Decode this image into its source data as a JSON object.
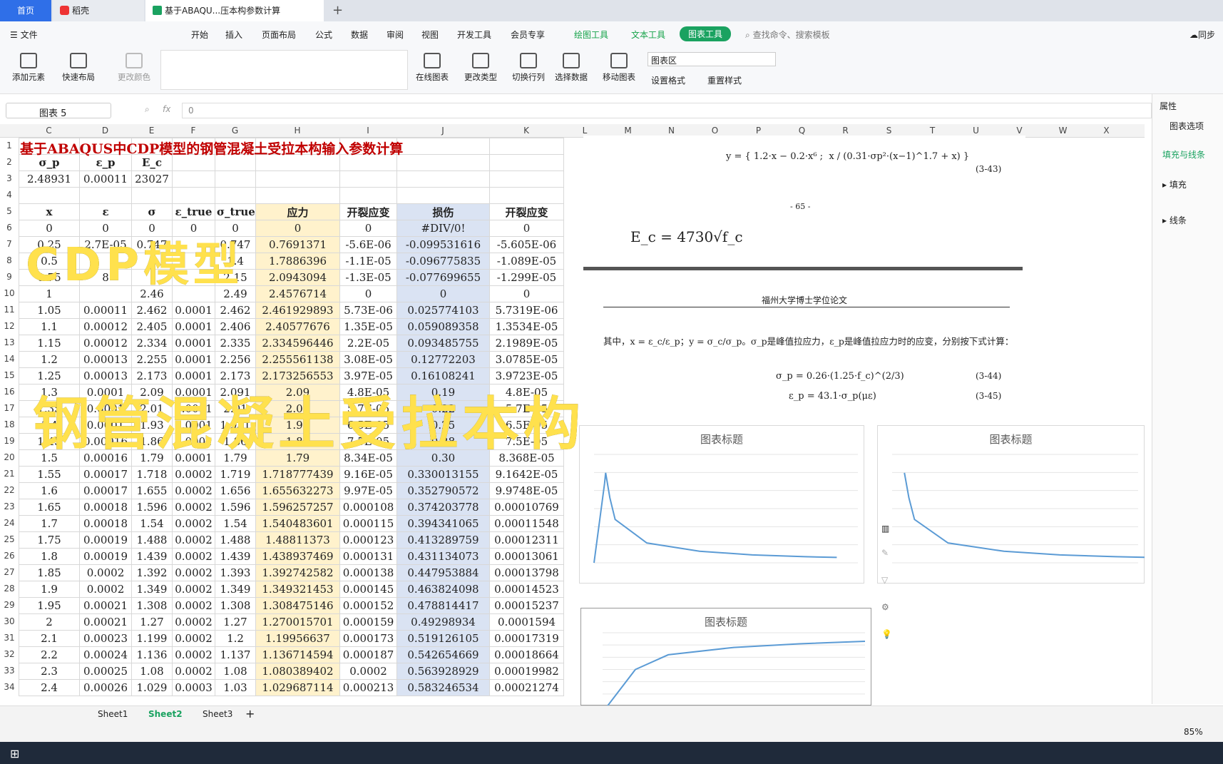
{
  "tabs": {
    "home": "首页",
    "daoke": "稻壳",
    "file": "基于ABAQU...压本构参数计算"
  },
  "menu": {
    "file": "文件",
    "items": [
      "开始",
      "插入",
      "页面布局",
      "公式",
      "数据",
      "审阅",
      "视图",
      "开发工具",
      "会员专享"
    ],
    "draw_tool": "绘图工具",
    "text_tool": "文本工具",
    "chart_tool": "图表工具",
    "search": "查找命令、搜索模板",
    "sync": "同步"
  },
  "ribbon": {
    "add_element": "添加元素",
    "quick_layout": "快速布局",
    "change_color": "更改颜色",
    "online_chart": "在线图表",
    "change_type": "更改类型",
    "switch_rowcol": "切换行列",
    "select_data": "选择数据",
    "move_chart": "移动图表",
    "chart_area": "图表区",
    "set_format": "设置格式",
    "reset_style": "重置样式"
  },
  "formula_bar": {
    "name_box": "图表 5",
    "fx": "fx",
    "value": "0"
  },
  "columns": [
    "C",
    "D",
    "E",
    "F",
    "G",
    "H",
    "I",
    "J",
    "K",
    "L",
    "M",
    "N",
    "O",
    "P",
    "Q",
    "R",
    "S",
    "T",
    "U",
    "V",
    "W",
    "X"
  ],
  "title": "基于ABAQUS中CDP模型的钢管混凝土受拉本构输入参数计算",
  "header_row2": [
    "σ_p",
    "ε_p",
    "E_c"
  ],
  "values_row3": [
    "2.48931",
    "0.00011",
    "23027"
  ],
  "header_row5": [
    "x",
    "ε",
    "σ",
    "ε_true",
    "σ_true",
    "应力",
    "开裂应变",
    "损伤",
    "开裂应变"
  ],
  "rows": [
    [
      "0",
      "0",
      "0",
      "0",
      "0",
      "0",
      "0",
      "#DIV/0!",
      "0"
    ],
    [
      "0.25",
      "2.7E-05",
      "0.747",
      "",
      "0.747",
      "0.7691371",
      "-5.6E-06",
      "-0.099531616",
      "-5.605E-06"
    ],
    [
      "0.5",
      "",
      "",
      "",
      "1.4",
      "1.7886396",
      "-1.1E-05",
      "-0.096775835",
      "-1.089E-05"
    ],
    [
      "0.75",
      "8",
      "",
      "",
      "2.15",
      "2.0943094",
      "-1.3E-05",
      "-0.077699655",
      "-1.299E-05"
    ],
    [
      "1",
      "",
      "2.46",
      "",
      "2.49",
      "2.4576714",
      "0",
      "0",
      "0"
    ],
    [
      "1.05",
      "0.00011",
      "2.462",
      "0.0001",
      "2.462",
      "2.461929893",
      "5.73E-06",
      "0.025774103",
      "5.7319E-06"
    ],
    [
      "1.1",
      "0.00012",
      "2.405",
      "0.0001",
      "2.406",
      "2.40577676",
      "1.35E-05",
      "0.059089358",
      "1.3534E-05"
    ],
    [
      "1.15",
      "0.00012",
      "2.334",
      "0.0001",
      "2.335",
      "2.334596446",
      "2.2E-05",
      "0.093485755",
      "2.1989E-05"
    ],
    [
      "1.2",
      "0.00013",
      "2.255",
      "0.0001",
      "2.256",
      "2.255561138",
      "3.08E-05",
      "0.12772203",
      "3.0785E-05"
    ],
    [
      "1.25",
      "0.00013",
      "2.173",
      "0.0001",
      "2.173",
      "2.173256553",
      "3.97E-05",
      "0.16108241",
      "3.9723E-05"
    ],
    [
      "1.3",
      "0.0001",
      "2.09",
      "0.0001",
      "2.091",
      "2.09",
      "4.8E-05",
      "0.19",
      "4.8E-05"
    ],
    [
      "1.35",
      "0.0001",
      "2.01",
      "0.0001",
      "2.01",
      "2.01",
      "5.7E-05",
      "0.22",
      "5.7E-05"
    ],
    [
      "1.4",
      "0.0001",
      "1.93",
      "0.0001",
      "1.931",
      "1.93",
      "6.5E-05",
      "0.25",
      "6.5E-05"
    ],
    [
      "1.45",
      "0.00016",
      "1.86",
      "0.0001",
      "1.86",
      "1.86",
      "7.5E-05",
      "0.28",
      "7.5E-05"
    ],
    [
      "1.5",
      "0.00016",
      "1.79",
      "0.0001",
      "1.79",
      "1.79",
      "8.34E-05",
      "0.30",
      "8.368E-05"
    ],
    [
      "1.55",
      "0.00017",
      "1.718",
      "0.0002",
      "1.719",
      "1.718777439",
      "9.16E-05",
      "0.330013155",
      "9.1642E-05"
    ],
    [
      "1.6",
      "0.00017",
      "1.655",
      "0.0002",
      "1.656",
      "1.655632273",
      "9.97E-05",
      "0.352790572",
      "9.9748E-05"
    ],
    [
      "1.65",
      "0.00018",
      "1.596",
      "0.0002",
      "1.596",
      "1.596257257",
      "0.000108",
      "0.374203778",
      "0.00010769"
    ],
    [
      "1.7",
      "0.00018",
      "1.54",
      "0.0002",
      "1.54",
      "1.540483601",
      "0.000115",
      "0.394341065",
      "0.00011548"
    ],
    [
      "1.75",
      "0.00019",
      "1.488",
      "0.0002",
      "1.488",
      "1.48811373",
      "0.000123",
      "0.413289759",
      "0.00012311"
    ],
    [
      "1.8",
      "0.00019",
      "1.439",
      "0.0002",
      "1.439",
      "1.438937469",
      "0.000131",
      "0.431134073",
      "0.00013061"
    ],
    [
      "1.85",
      "0.0002",
      "1.392",
      "0.0002",
      "1.393",
      "1.392742582",
      "0.000138",
      "0.447953884",
      "0.00013798"
    ],
    [
      "1.9",
      "0.0002",
      "1.349",
      "0.0002",
      "1.349",
      "1.349321453",
      "0.000145",
      "0.463824098",
      "0.00014523"
    ],
    [
      "1.95",
      "0.00021",
      "1.308",
      "0.0002",
      "1.308",
      "1.308475146",
      "0.000152",
      "0.478814417",
      "0.00015237"
    ],
    [
      "2",
      "0.00021",
      "1.27",
      "0.0002",
      "1.27",
      "1.270015701",
      "0.000159",
      "0.49298934",
      "0.0001594"
    ],
    [
      "2.1",
      "0.00023",
      "1.199",
      "0.0002",
      "1.2",
      "1.19956637",
      "0.000173",
      "0.519126105",
      "0.00017319"
    ],
    [
      "2.2",
      "0.00024",
      "1.136",
      "0.0002",
      "1.137",
      "1.136714594",
      "0.000187",
      "0.542654669",
      "0.00018664"
    ],
    [
      "2.3",
      "0.00025",
      "1.08",
      "0.0002",
      "1.08",
      "1.080389402",
      "0.0002",
      "0.563928929",
      "0.00019982"
    ],
    [
      "2.4",
      "0.00026",
      "1.029",
      "0.0003",
      "1.03",
      "1.029687114",
      "0.000213",
      "0.583246534",
      "0.00021274"
    ]
  ],
  "overlay": {
    "line1": "CDP模型",
    "line2": "钢管混凝土受拉本构"
  },
  "doc": {
    "thesis": "福州大学博士学位论文",
    "page": "- 65 -",
    "eq343": "(3-43)",
    "eq344": "(3-44)",
    "eq345": "(3-45)",
    "ec": "E_c = 4730√f_c",
    "where": "其中，x = ε_c/ε_p；y = σ_c/σ_p。σ_p是峰值拉应力，ε_p是峰值拉应力时的应变，分别按下式计算：",
    "sp": "σ_p = 0.26·(1.25·f_c)^(2/3)",
    "ep": "ε_p = 43.1·σ_p(με)"
  },
  "charts": [
    {
      "title": "图表标题"
    },
    {
      "title": "图表标题"
    },
    {
      "title": "图表标题"
    }
  ],
  "chart_data": [
    {
      "type": "line",
      "title": "图表标题",
      "x": [
        0,
        0.0001,
        0.00011,
        0.00015,
        0.0002,
        0.0005,
        0.001,
        0.0015,
        0.002,
        0.0023
      ],
      "values": [
        0,
        2.2,
        2.49,
        1.8,
        1.2,
        0.55,
        0.32,
        0.22,
        0.17,
        0.15
      ],
      "ylim": [
        0,
        3
      ],
      "xlim": [
        0,
        0.0025
      ]
    },
    {
      "type": "line",
      "title": "图表标题",
      "x": [
        0.00011,
        0.00015,
        0.0002,
        0.0005,
        0.001,
        0.0015,
        0.002,
        0.0023
      ],
      "values": [
        2.49,
        1.8,
        1.2,
        0.55,
        0.32,
        0.22,
        0.17,
        0.15
      ],
      "ylim": [
        0,
        3
      ],
      "xlim": [
        0,
        0.0022
      ]
    },
    {
      "type": "line",
      "title": "图表标题",
      "x": [
        0,
        0.00025,
        0.0005,
        0.001,
        0.0015,
        0.002
      ],
      "values": [
        0.35,
        0.7,
        0.82,
        0.88,
        0.91,
        0.93
      ],
      "ylim": [
        0.4,
        1
      ]
    }
  ],
  "panel": {
    "prop": "属性",
    "chart_opts": "图表选项",
    "fill_line": "填充与线条",
    "fill": "填充",
    "line": "线条"
  },
  "sheets": [
    "Sheet1",
    "Sheet2",
    "Sheet3"
  ],
  "zoom": "85%"
}
